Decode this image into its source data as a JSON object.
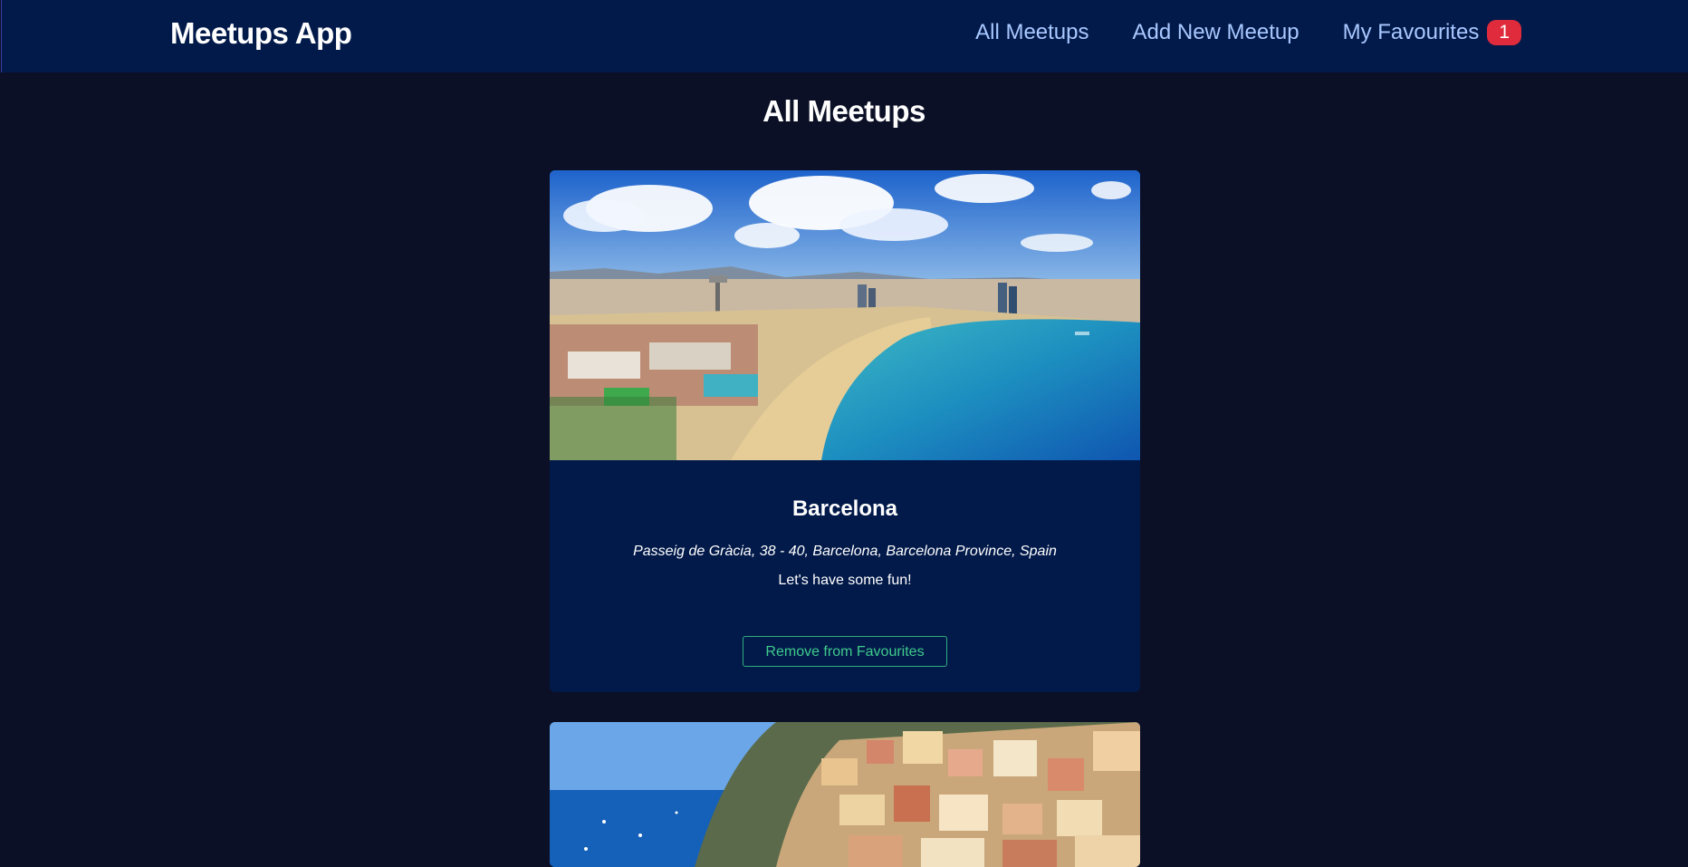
{
  "header": {
    "logo": "Meetups App",
    "nav": {
      "all_meetups": "All Meetups",
      "add_new_meetup": "Add New Meetup",
      "my_favourites": "My Favourites",
      "favourites_count": "1"
    },
    "badge_color": "#e02b3d",
    "link_color": "#a9c8ff"
  },
  "main": {
    "title": "All Meetups",
    "meetups": [
      {
        "title": "Barcelona",
        "address": "Passeig de Gràcia, 38 - 40, Barcelona, Barcelona Province, Spain",
        "description": "Let's have some fun!",
        "button_label": "Remove from Favourites",
        "image": "barcelona-beach-image"
      },
      {
        "image": "positano-coast-image"
      }
    ]
  },
  "colors": {
    "background": "#0b1026",
    "header_bg": "#021a4a",
    "card_bg": "#021a4a",
    "button_accent": "#3fcb8c"
  }
}
